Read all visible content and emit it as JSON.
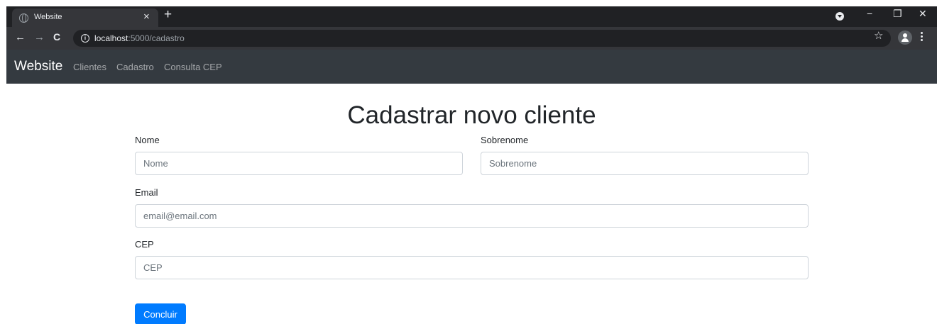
{
  "browser": {
    "tab_title": "Website",
    "tab_close": "×",
    "new_tab": "+",
    "window_controls": {
      "minimize": "−",
      "restore": "❐",
      "close": "✕"
    },
    "nav": {
      "back": "←",
      "forward": "→",
      "reload": "C"
    },
    "url_host": "localhost",
    "url_rest": ":5000/cadastro",
    "star": "☆"
  },
  "navbar": {
    "brand": "Website",
    "links": [
      "Clientes",
      "Cadastro",
      "Consulta CEP"
    ]
  },
  "form": {
    "title": "Cadastrar novo cliente",
    "nome": {
      "label": "Nome",
      "placeholder": "Nome"
    },
    "sobrenome": {
      "label": "Sobrenome",
      "placeholder": "Sobrenome"
    },
    "email": {
      "label": "Email",
      "placeholder": "email@email.com"
    },
    "cep": {
      "label": "CEP",
      "placeholder": "CEP"
    },
    "submit_label": "Concluir"
  },
  "colors": {
    "navbar_bg": "#343a40",
    "primary": "#007bff",
    "chrome_dark": "#202124",
    "chrome_toolbar": "#35363a"
  }
}
